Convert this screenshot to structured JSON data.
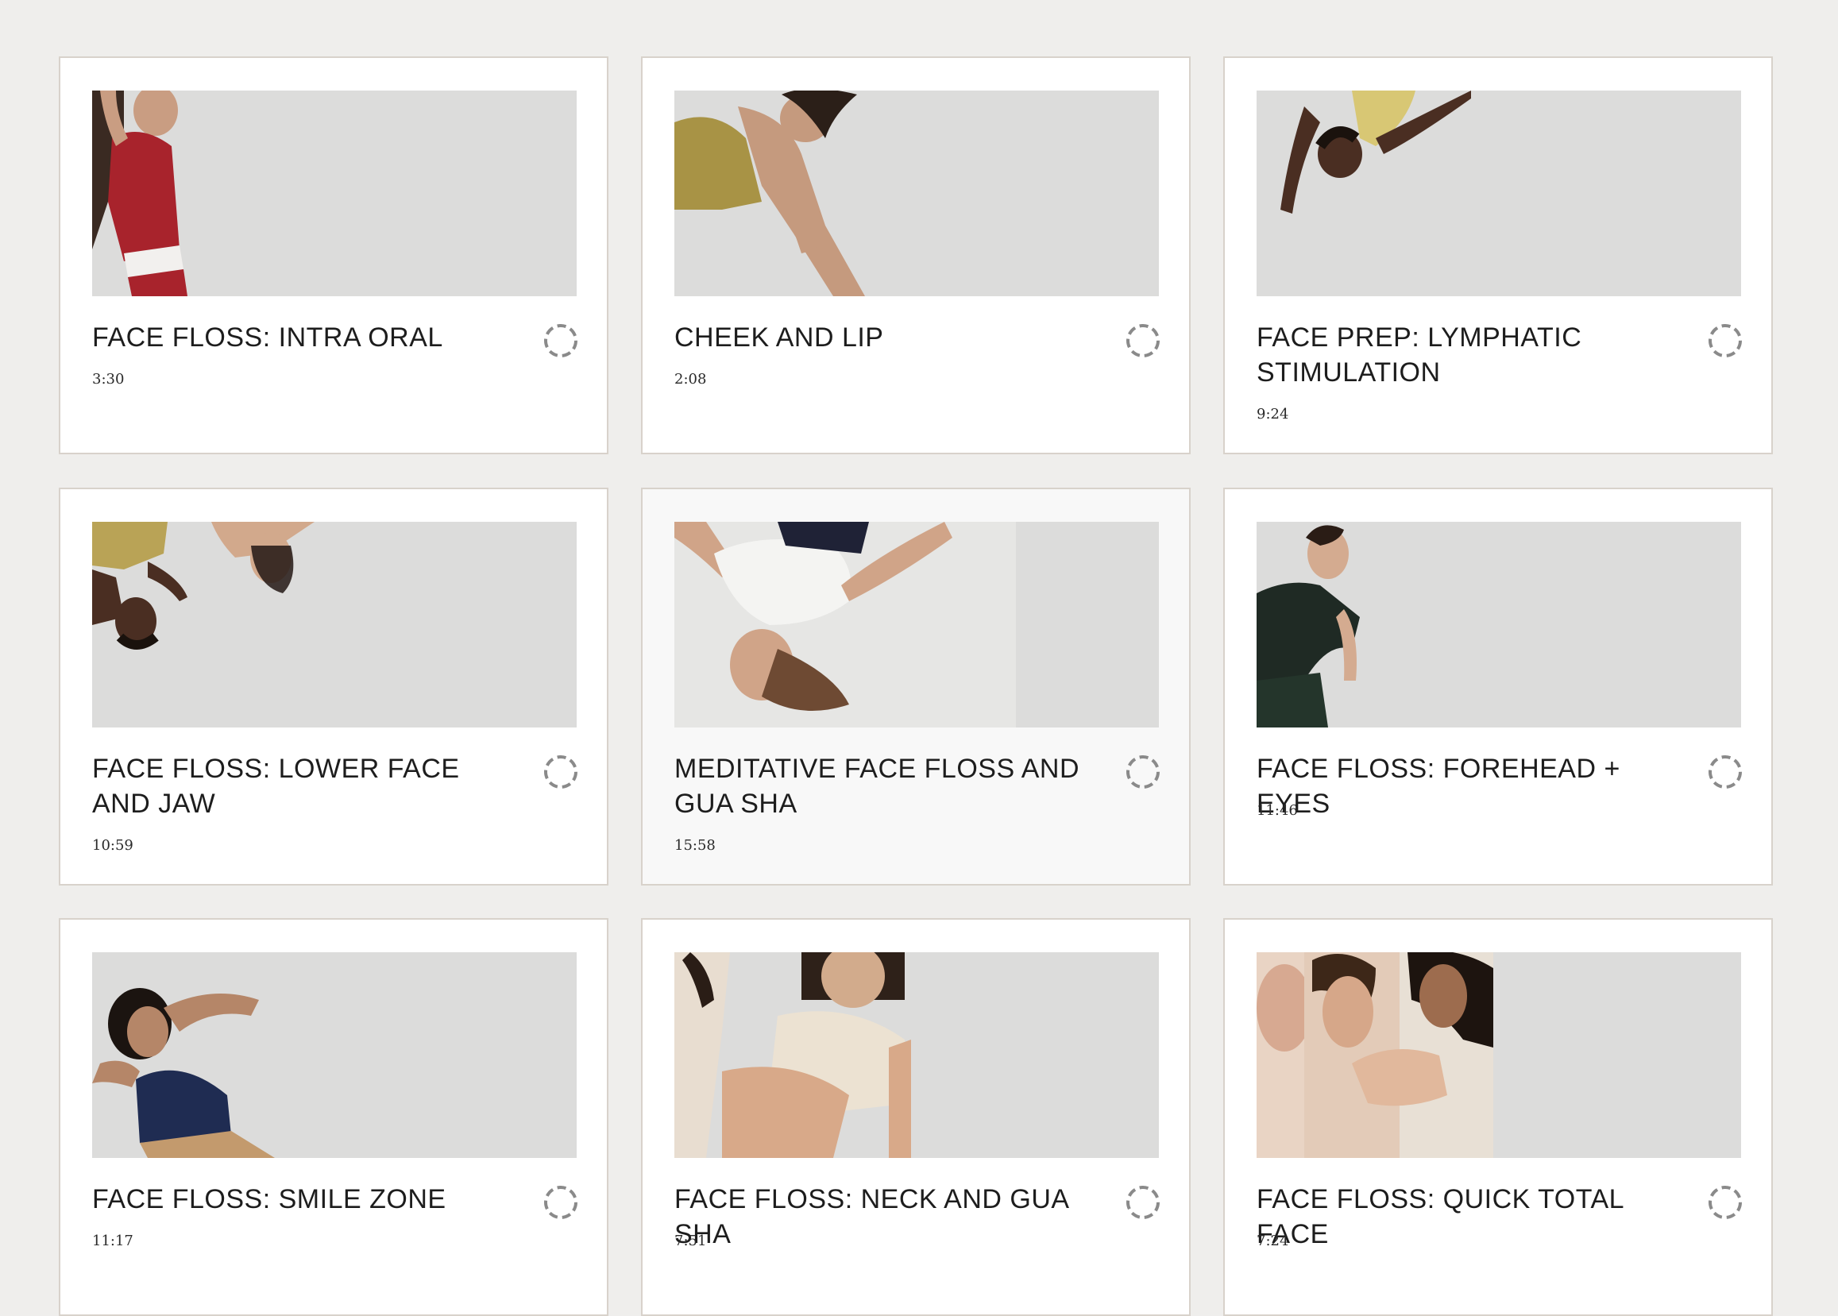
{
  "colors": {
    "page_background": "#efeeec",
    "card_background": "#ffffff",
    "card_hover_background": "#f8f8f8",
    "card_border": "#d8d2cb",
    "thumbnail_background": "#dcdcdb",
    "text": "#1d1d1d",
    "status_ring": "#8a8a8a"
  },
  "videos": [
    {
      "title": "FACE FLOSS: INTRA ORAL",
      "duration": "3:30",
      "status_icon": "incomplete-dashed-circle-icon"
    },
    {
      "title": "CHEEK AND LIP",
      "duration": "2:08",
      "status_icon": "incomplete-dashed-circle-icon"
    },
    {
      "title": "FACE PREP: LYMPHATIC STIMULATION",
      "duration": "9:24",
      "status_icon": "incomplete-dashed-circle-icon"
    },
    {
      "title": "FACE FLOSS: LOWER FACE AND JAW",
      "duration": "10:59",
      "status_icon": "incomplete-dashed-circle-icon"
    },
    {
      "title": "MEDITATIVE FACE FLOSS AND GUA SHA",
      "duration": "15:58",
      "status_icon": "incomplete-dashed-circle-icon"
    },
    {
      "title": "FACE FLOSS: FOREHEAD + EYES",
      "duration": "11:46",
      "status_icon": "incomplete-dashed-circle-icon"
    },
    {
      "title": "FACE FLOSS: SMILE ZONE",
      "duration": "11:17",
      "status_icon": "incomplete-dashed-circle-icon"
    },
    {
      "title": "FACE FLOSS: NECK AND GUA SHA",
      "duration": "7:51",
      "status_icon": "incomplete-dashed-circle-icon"
    },
    {
      "title": "FACE FLOSS: QUICK TOTAL FACE",
      "duration": "7:24",
      "status_icon": "incomplete-dashed-circle-icon"
    }
  ]
}
